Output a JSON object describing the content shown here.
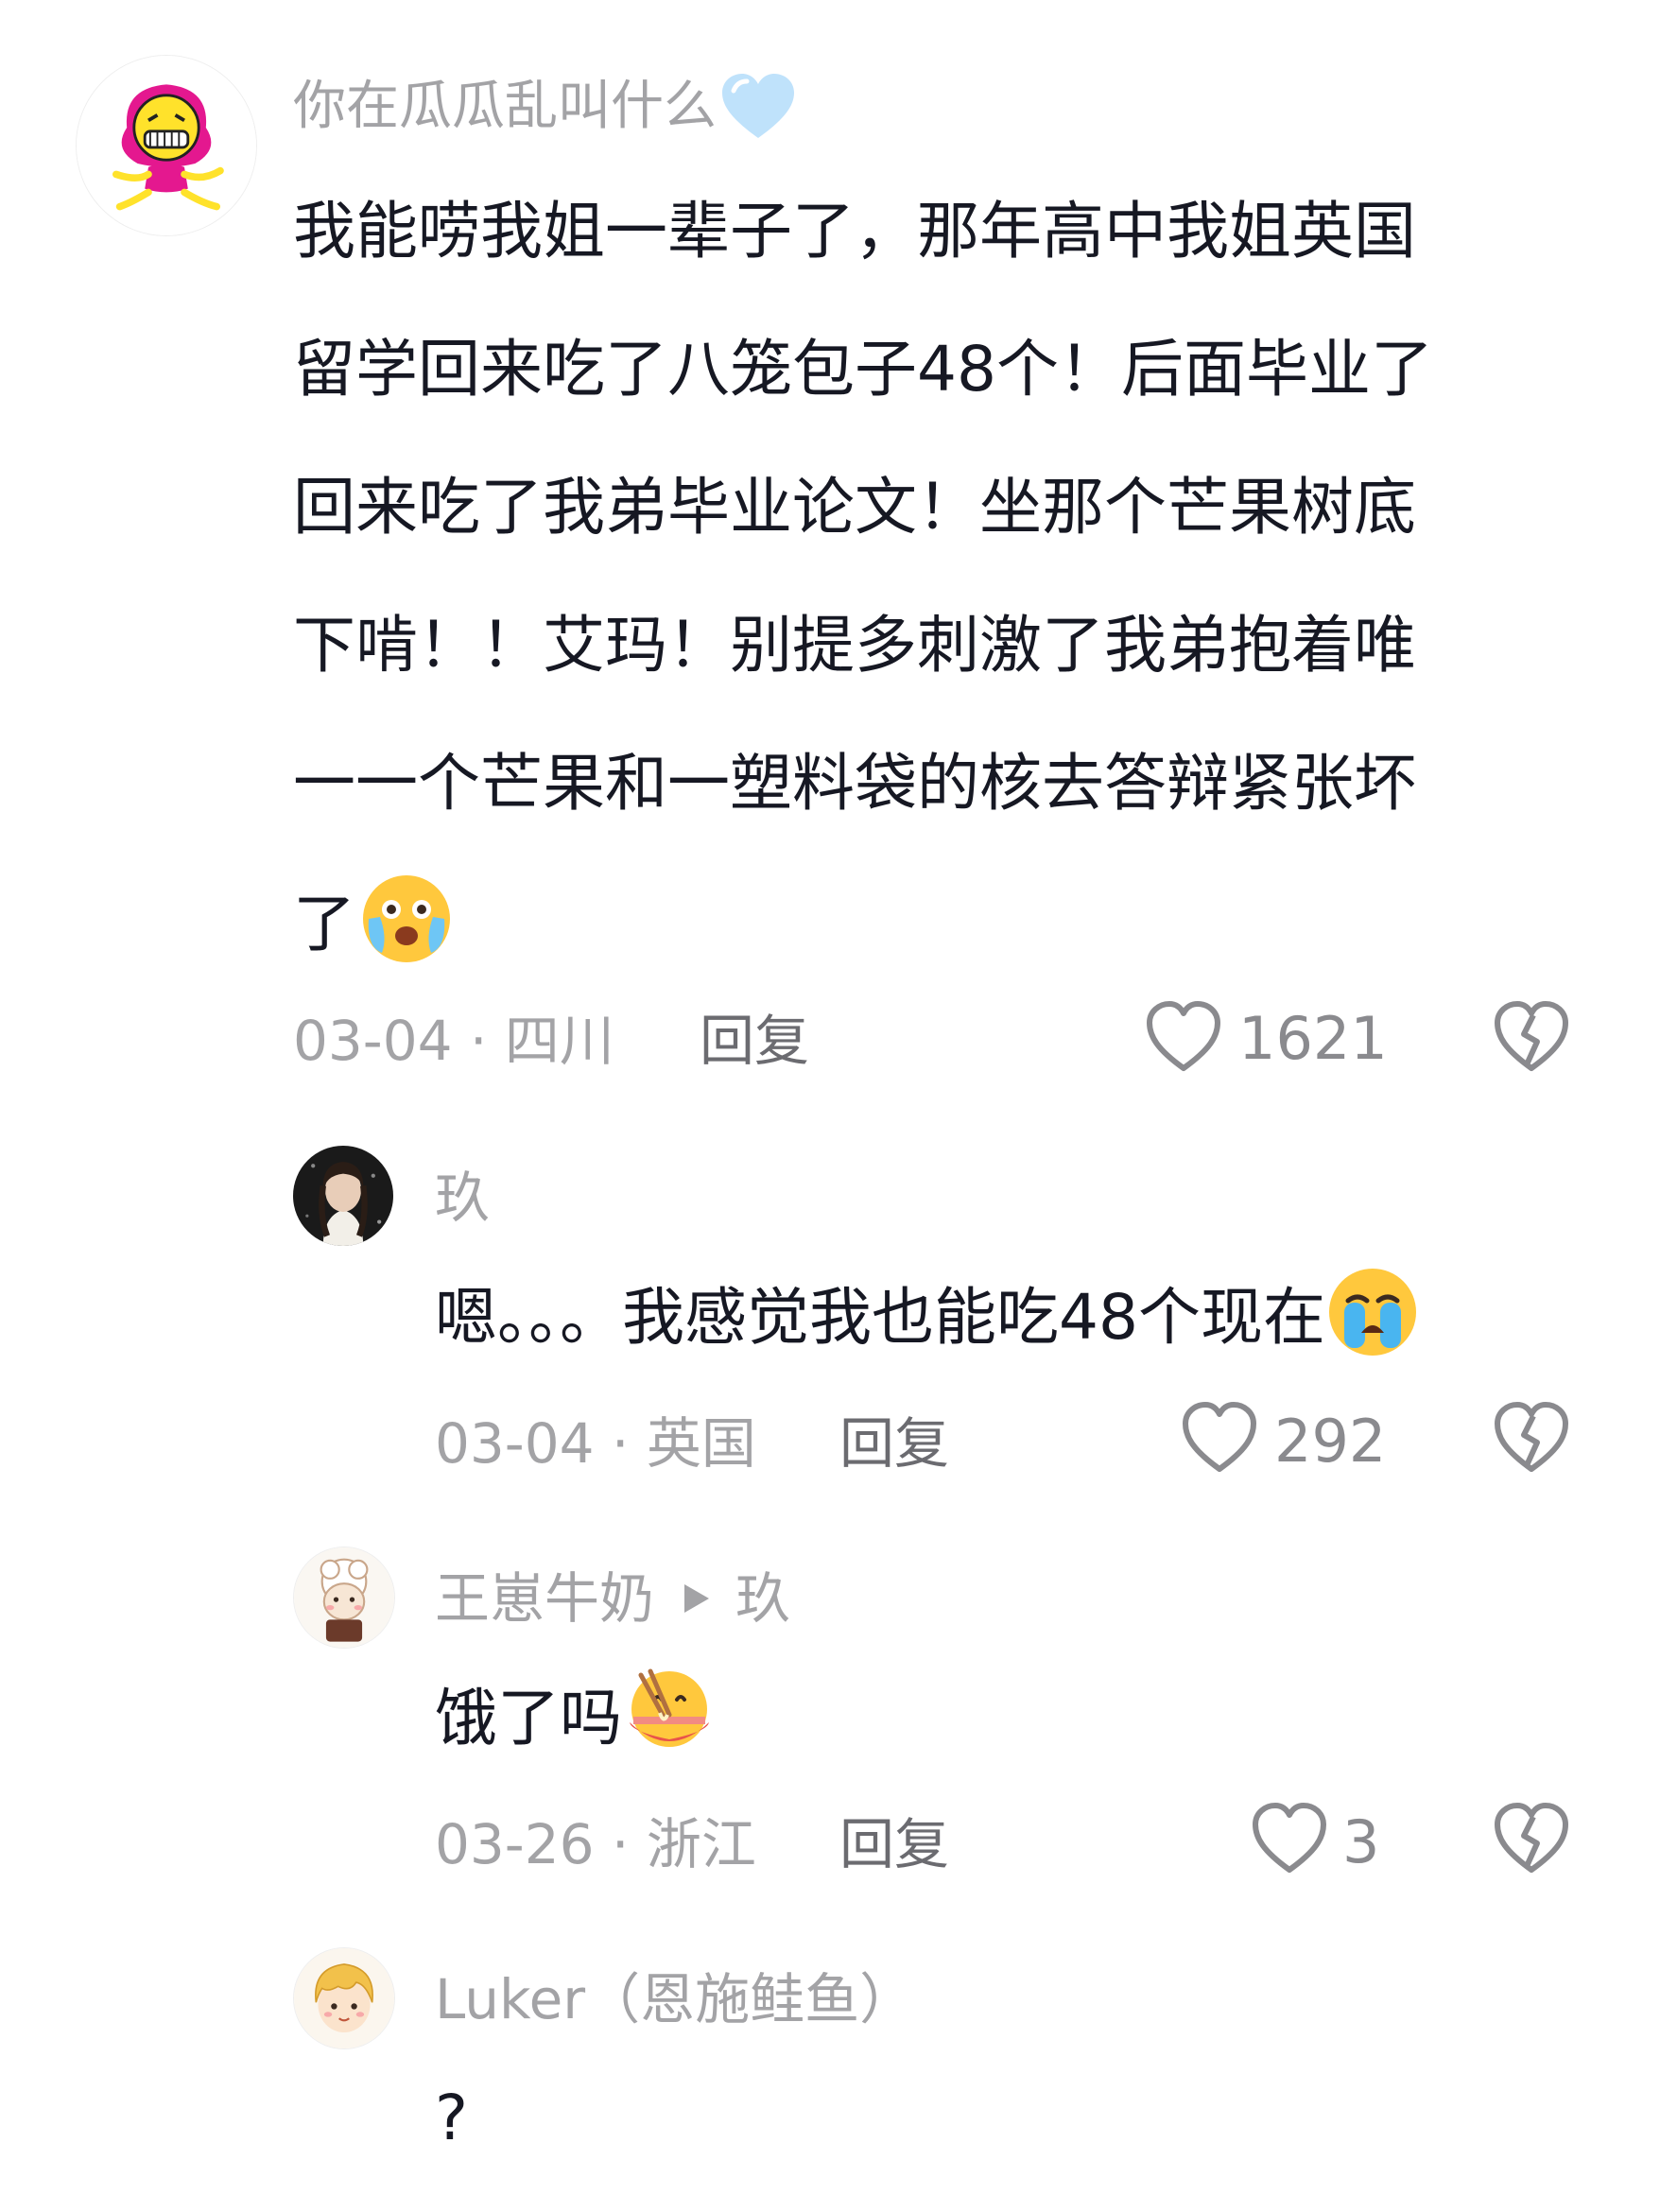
{
  "comments": [
    {
      "username": "你在瓜瓜乱叫什么",
      "lines": [
        "我能唠我姐一辈子了，那年高中我姐英国",
        "留学回来吃了八笼包子48个！后面毕业了",
        "回来吃了我弟毕业论文！坐那个芒果树底",
        "下啃！！艾玛！别提多刺激了我弟抱着唯",
        "一一个芒果和一塑料袋的核去答辩紧张坏",
        "了"
      ],
      "date_location": "03-04 · 四川",
      "reply_label": "回复",
      "likes": "1621"
    },
    {
      "username": "玖",
      "text": "嗯。。。我感觉我也能吃48个现在",
      "date_location": "03-04 · 英国",
      "reply_label": "回复",
      "likes": "292"
    },
    {
      "username": "王崽牛奶",
      "reply_to": "玖",
      "text": "饿了吗",
      "date_location": "03-26 · 浙江",
      "reply_label": "回复",
      "likes": "3"
    },
    {
      "username": "Luker（恩施鲑鱼）",
      "text": "?"
    }
  ],
  "icons": {
    "like": "heart-outline-icon",
    "dislike": "broken-heart-icon",
    "reply_arrow": "play-triangle-icon"
  },
  "colors": {
    "text": "#161823",
    "secondary": "#a3a3a6",
    "icon": "#8a8a8e"
  }
}
